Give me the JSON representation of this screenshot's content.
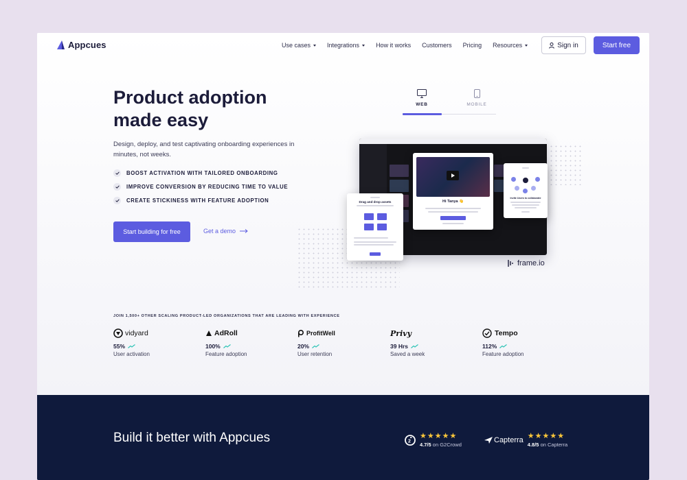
{
  "nav": {
    "logo": "Appcues",
    "items": [
      {
        "label": "Use cases",
        "dropdown": true
      },
      {
        "label": "Integrations",
        "dropdown": true
      },
      {
        "label": "How it works",
        "dropdown": false
      },
      {
        "label": "Customers",
        "dropdown": false
      },
      {
        "label": "Pricing",
        "dropdown": false
      },
      {
        "label": "Resources",
        "dropdown": true
      }
    ],
    "sign_in": "Sign in",
    "start_free": "Start free"
  },
  "hero": {
    "title_line1": "Product adoption",
    "title_line2": "made easy",
    "subtitle": "Design, deploy, and test captivating onboarding experiences in minutes, not weeks.",
    "bullets": [
      "BOOST ACTIVATION WITH TAILORED ONBOARDING",
      "IMPROVE CONVERSION BY REDUCING TIME TO VALUE",
      "CREATE STICKINESS WITH FEATURE ADOPTION"
    ],
    "cta": "Start building for free",
    "demo_link": "Get a demo"
  },
  "tabs": {
    "web": "WEB",
    "mobile": "MOBILE",
    "active": "web"
  },
  "mock": {
    "modal_title": "Hi Tanya 👋",
    "left_title": "Drag and drop assets",
    "right_title": "Invite Users to collaborate",
    "partner_logo": "frame.io"
  },
  "proof": {
    "heading": "JOIN 1,500+ OTHER SCALING PRODUCT-LED ORGANIZATIONS THAT ARE LEADING WITH EXPERIENCE",
    "stats": [
      {
        "brand": "vidyard",
        "value": "55%",
        "label": "User activation"
      },
      {
        "brand": "AdRoll",
        "value": "100%",
        "label": "Feature adoption"
      },
      {
        "brand": "ProfitWell",
        "value": "20%",
        "label": "User retention"
      },
      {
        "brand": "Privy",
        "value": "39 Hrs",
        "label": "Saved a week"
      },
      {
        "brand": "Tempo",
        "value": "112%",
        "label": "Feature adoption"
      }
    ]
  },
  "band": {
    "heading": "Build it better with Appcues",
    "ratings": [
      {
        "source": "G2",
        "score": "4.7/5",
        "suffix": "on G2Crowd",
        "stars": "★★★★★"
      },
      {
        "source": "Capterra",
        "score": "4.8/5",
        "suffix": "on Capterra",
        "stars": "★★★★★"
      }
    ]
  },
  "colors": {
    "accent": "#5c5ce0",
    "navy": "#0f1a3c",
    "star": "#f8c53a",
    "trend": "#2ec4b6"
  }
}
